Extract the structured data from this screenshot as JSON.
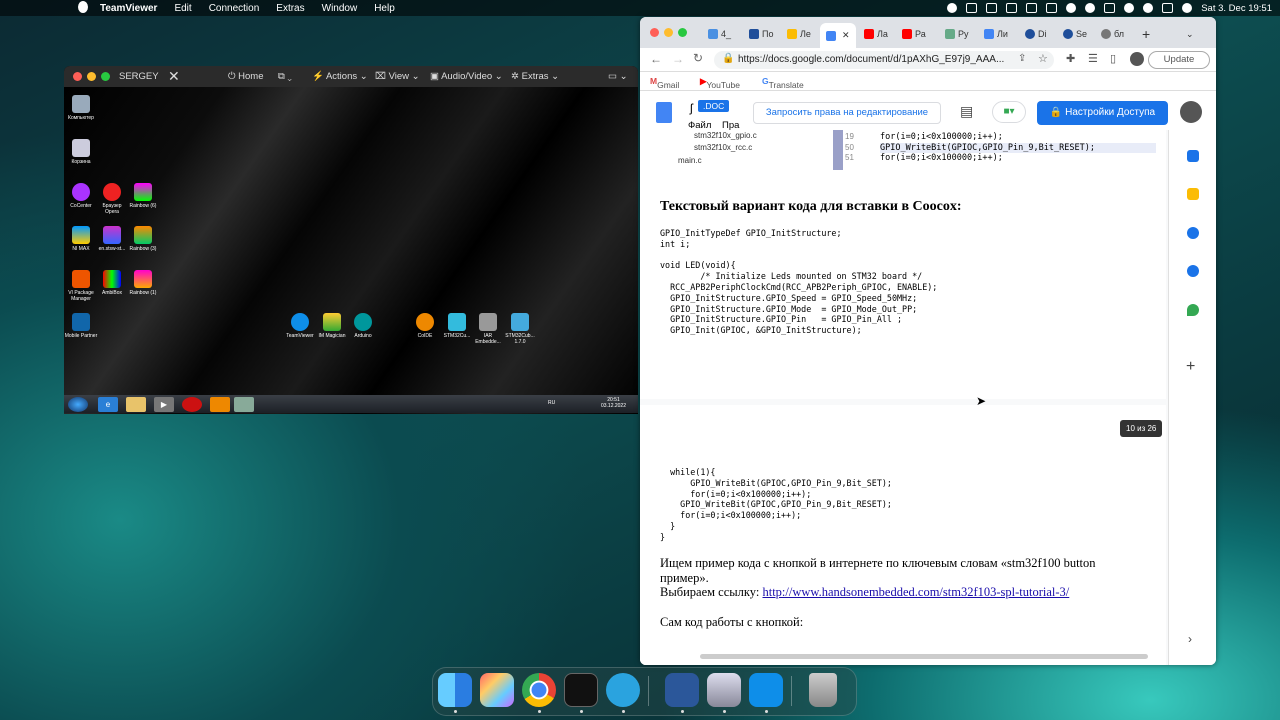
{
  "menubar": {
    "app": "TeamViewer",
    "items": [
      "Edit",
      "Connection",
      "Extras",
      "Window",
      "Help"
    ],
    "date_time": "Sat 3. Dec  19:51"
  },
  "teamviewer": {
    "title": "SERGEY",
    "toolbar": [
      "Home",
      "Actions",
      "View",
      "Audio/Video",
      "Extras"
    ],
    "desktop_icons": [
      {
        "label": "Компьютер"
      },
      {
        "label": "Корзина"
      },
      {
        "label": "CoCenter"
      },
      {
        "label": "Браузер Opera"
      },
      {
        "label": "Rainbow (6)"
      },
      {
        "label": "NI MAX"
      },
      {
        "label": "en.stsw-st..."
      },
      {
        "label": "Rainbow (3)"
      },
      {
        "label": "VI Package Manager"
      },
      {
        "label": "AmbiBox"
      },
      {
        "label": "Rainbow (1)"
      },
      {
        "label": "Mobile Partner"
      },
      {
        "label": "TeamViewer"
      },
      {
        "label": "IM Magician"
      },
      {
        "label": "Arduino"
      },
      {
        "label": "CoIDE"
      },
      {
        "label": "STM32Cu..."
      },
      {
        "label": "IAR Embedde..."
      },
      {
        "label": "STM32Cub... 1.7.0"
      }
    ],
    "win_clock": {
      "time": "20:51",
      "date": "03.12.2022",
      "lang": "RU"
    }
  },
  "browser": {
    "tabs": [
      "4_",
      "По",
      "Ле",
      "",
      "Ла",
      "Ра",
      "Ру",
      "Ли",
      "Di",
      "Se",
      "бл"
    ],
    "url": "https://docs.google.com/document/d/1pAXhG_E97j9_AAA...",
    "update_label": "Update",
    "bookmarks": [
      "Gmail",
      "YouTube",
      "Translate"
    ],
    "doc": {
      "logo_suffix": ".DOC",
      "menu": [
        "Файл",
        "Пра"
      ],
      "request_btn": "Запросить права на редактирование",
      "share_btn": "Настройки Доступа",
      "tree_items": [
        "stm32f10x_gpio.c",
        "stm32f10x_rcc.c",
        "main.c"
      ],
      "screenshot_lines": [
        "for(i=0;i<0x100000;i++);",
        "GPIO_WriteBit(GPIOC,GPIO_Pin_9,Bit_RESET);",
        "for(i=0;i<0x100000;i++);"
      ],
      "line_numbers": [
        "19",
        "50",
        "51"
      ],
      "heading": "Текстовый вариант кода для вставки в Coocox:",
      "code1": "GPIO_InitTypeDef GPIO_InitStructure;\nint i;\n\nvoid LED(void){\n        /* Initialize Leds mounted on STM32 board */\n  RCC_APB2PeriphClockCmd(RCC_APB2Periph_GPIOC, ENABLE);\n  GPIO_InitStructure.GPIO_Speed = GPIO_Speed_50MHz;\n  GPIO_InitStructure.GPIO_Mode  = GPIO_Mode_Out_PP;\n  GPIO_InitStructure.GPIO_Pin   = GPIO_Pin_All ;\n  GPIO_Init(GPIOC, &GPIO_InitStructure);",
      "code2": "  while(1){\n      GPIO_WriteBit(GPIOC,GPIO_Pin_9,Bit_SET);\n      for(i=0;i<0x100000;i++);\n    GPIO_WriteBit(GPIOC,GPIO_Pin_9,Bit_RESET);\n    for(i=0;i<0x100000;i++);\n  }\n}",
      "page_badge": "10 из 26",
      "para1": "Ищем пример кода с кнопкой в интернете по ключевым словам «stm32f100 button пример».",
      "para2_prefix": "Выбираем ссылку: ",
      "link": "http://www.handsonembedded.com/stm32f103-spl-tutorial-3/",
      "para3": "Сам код работы с кнопкой:"
    }
  },
  "dock": [
    "Finder",
    "Launchpad",
    "Chrome",
    "Terminal",
    "Telegram",
    "Word",
    "Preview",
    "TeamViewer",
    "Trash"
  ],
  "colors": {
    "share": "#1a73e8",
    "tv_blue": "#0e8ee9"
  }
}
